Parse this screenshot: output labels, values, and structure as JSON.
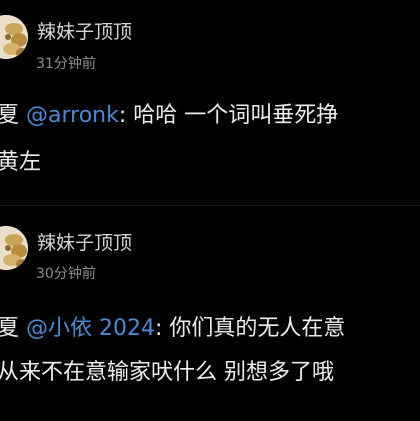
{
  "comments": [
    {
      "username": "辣妹子顶顶",
      "timestamp": "31分钟前",
      "reply_prefix": "夏 ",
      "mention": "@arronk",
      "text_line1": ": 哈哈 一个词叫垂死挣",
      "text_line2": "黄左"
    },
    {
      "username": "辣妹子顶顶",
      "timestamp": "30分钟前",
      "reply_prefix": "夏 ",
      "mention": "@小依 2024",
      "text_line1": ": 你们真的无人在意",
      "text_line2": "从来不在意输家吠什么 别想多了哦"
    }
  ],
  "colors": {
    "background": "#000000",
    "text": "#eeeeee",
    "username": "#d6d6d6",
    "timestamp": "#8d8d8d",
    "mention": "#4c8bd3"
  },
  "icons": {
    "avatar": "food-avatar-icon"
  }
}
